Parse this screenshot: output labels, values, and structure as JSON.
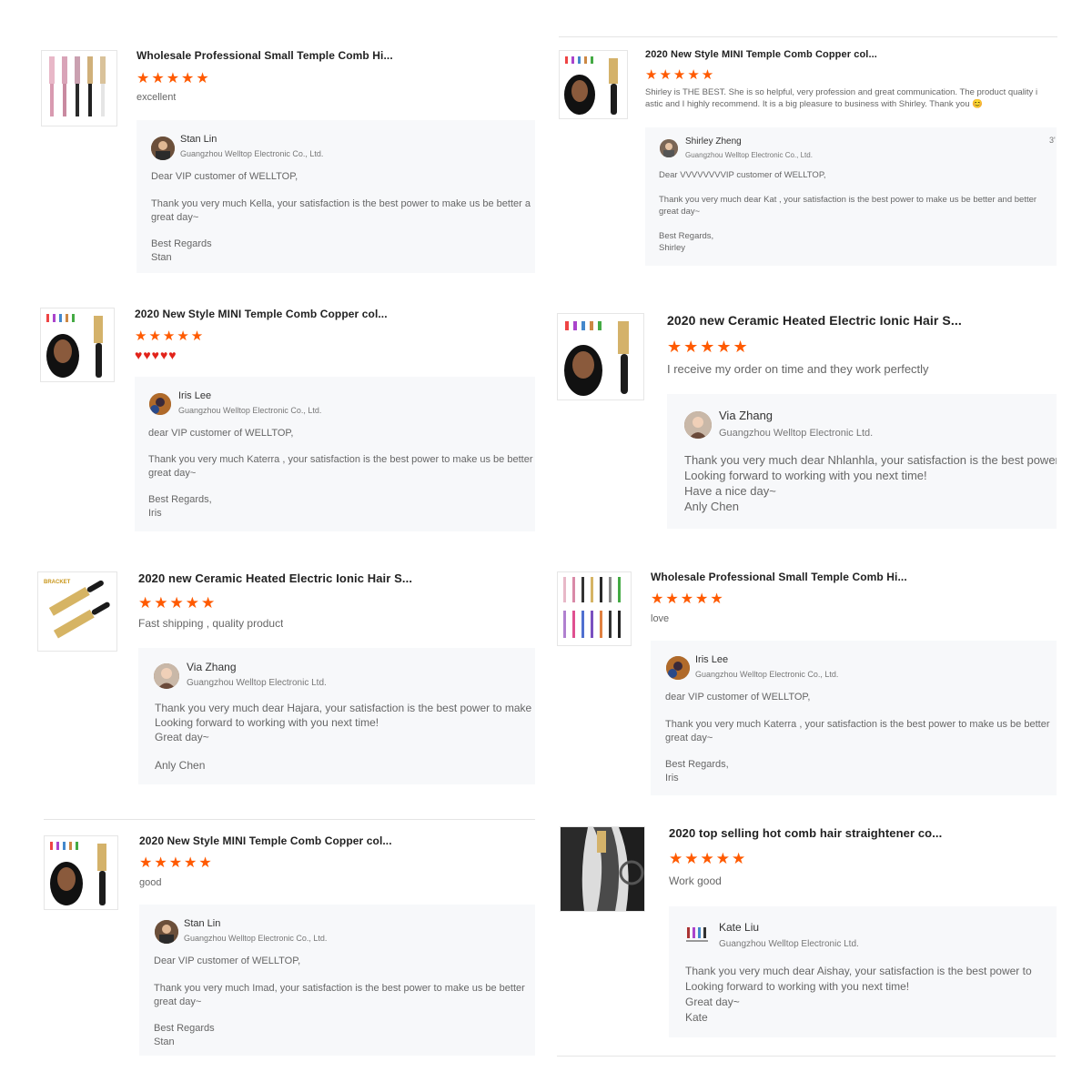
{
  "reviews": [
    {
      "title": "Wholesale Professional Small Temple Comb Hi...",
      "stars": "★★★★★",
      "comment": "excellent",
      "reply": {
        "name": "Stan Lin",
        "company": "Guangzhou Welltop Electronic Co., Ltd.",
        "lines": [
          "Dear VIP customer of WELLTOP,",
          "Thank you very much Kella, your satisfaction is the best power to make us be better a",
          "great day~",
          "Best Regards",
          "Stan"
        ]
      }
    },
    {
      "title": "2020 New Style MINI Temple Comb Copper col...",
      "stars": "★★★★★",
      "comment": "Shirley is THE BEST. She is so helpful, very profession and great communication. The product quality i",
      "comment2": "astic and I highly recommend. It is a big pleasure to business with Shirley. Thank you 😊",
      "reply": {
        "name": "Shirley Zheng",
        "company": "Guangzhou Welltop Electronic Co., Ltd.",
        "corner": "3'",
        "lines": [
          "Dear VVVVVVVVIP customer of WELLTOP,",
          "Thank you very much dear Kat , your satisfaction is the best power to make us be better and better",
          "great day~",
          "Best Regards,",
          "Shirley"
        ]
      }
    },
    {
      "title": "2020 New Style MINI Temple Comb Copper col...",
      "stars": "★★★★★",
      "hearts": "♥♥♥♥♥",
      "reply": {
        "name": "Iris Lee",
        "company": "Guangzhou Welltop Electronic Co., Ltd.",
        "lines": [
          "dear VIP customer of WELLTOP,",
          "Thank you very much Katerra , your satisfaction is the best power to make us be better",
          "great day~",
          "Best Regards,",
          "Iris"
        ]
      }
    },
    {
      "title": "2020 new Ceramic Heated Electric Ionic Hair S...",
      "stars": "★★★★★",
      "comment": "I receive my order on time and they work perfectly",
      "reply": {
        "name": "Via Zhang",
        "company": "Guangzhou Welltop Electronic Ltd.",
        "lines": [
          "Thank you very much dear Nhlanhla, your satisfaction is the best power",
          "Looking forward to working with you next time!",
          "Have a nice day~",
          "Anly  Chen"
        ]
      }
    },
    {
      "title": "2020 new Ceramic Heated Electric Ionic Hair S...",
      "stars": "★★★★★",
      "comment": "Fast shipping , quality product",
      "reply": {
        "name": "Via Zhang",
        "company": "Guangzhou Welltop Electronic Ltd.",
        "lines": [
          "Thank you very much dear Hajara, your satisfaction is the best power to make u",
          "Looking forward to working with you next time!",
          "Great day~",
          "Anly  Chen"
        ]
      }
    },
    {
      "title": "Wholesale Professional Small Temple Comb Hi...",
      "stars": "★★★★★",
      "comment": "love",
      "reply": {
        "name": "Iris Lee",
        "company": "Guangzhou Welltop Electronic Co., Ltd.",
        "lines": [
          "dear VIP customer of WELLTOP,",
          "Thank you very much Katerra , your satisfaction is the best power to make us be better",
          "great day~",
          "Best Regards,",
          "Iris"
        ]
      }
    },
    {
      "title": "2020 New Style MINI Temple Comb Copper col...",
      "stars": "★★★★★",
      "comment": "good",
      "reply": {
        "name": "Stan Lin",
        "company": "Guangzhou Welltop Electronic Co., Ltd.",
        "lines": [
          "Dear VIP customer of WELLTOP,",
          "Thank you very much Imad, your satisfaction is the best power to make us be better",
          "great day~",
          "Best Regards",
          "Stan"
        ]
      }
    },
    {
      "title": "2020 top selling hot comb hair straightener co...",
      "stars": "★★★★★",
      "comment": "Work good",
      "reply": {
        "name": "Kate Liu",
        "company": "Guangzhou Welltop Electronic Ltd.",
        "lines": [
          "Thank you very much dear Aishay,  your satisfaction is the best power to",
          "Looking forward to working with you next time!",
          "Great day~",
          "Kate"
        ]
      }
    }
  ],
  "thumb_badge": "BRACKET",
  "colors": {
    "star": "#ff5a00",
    "heart": "#e2231a",
    "reply_bg": "#f7f8fa"
  }
}
